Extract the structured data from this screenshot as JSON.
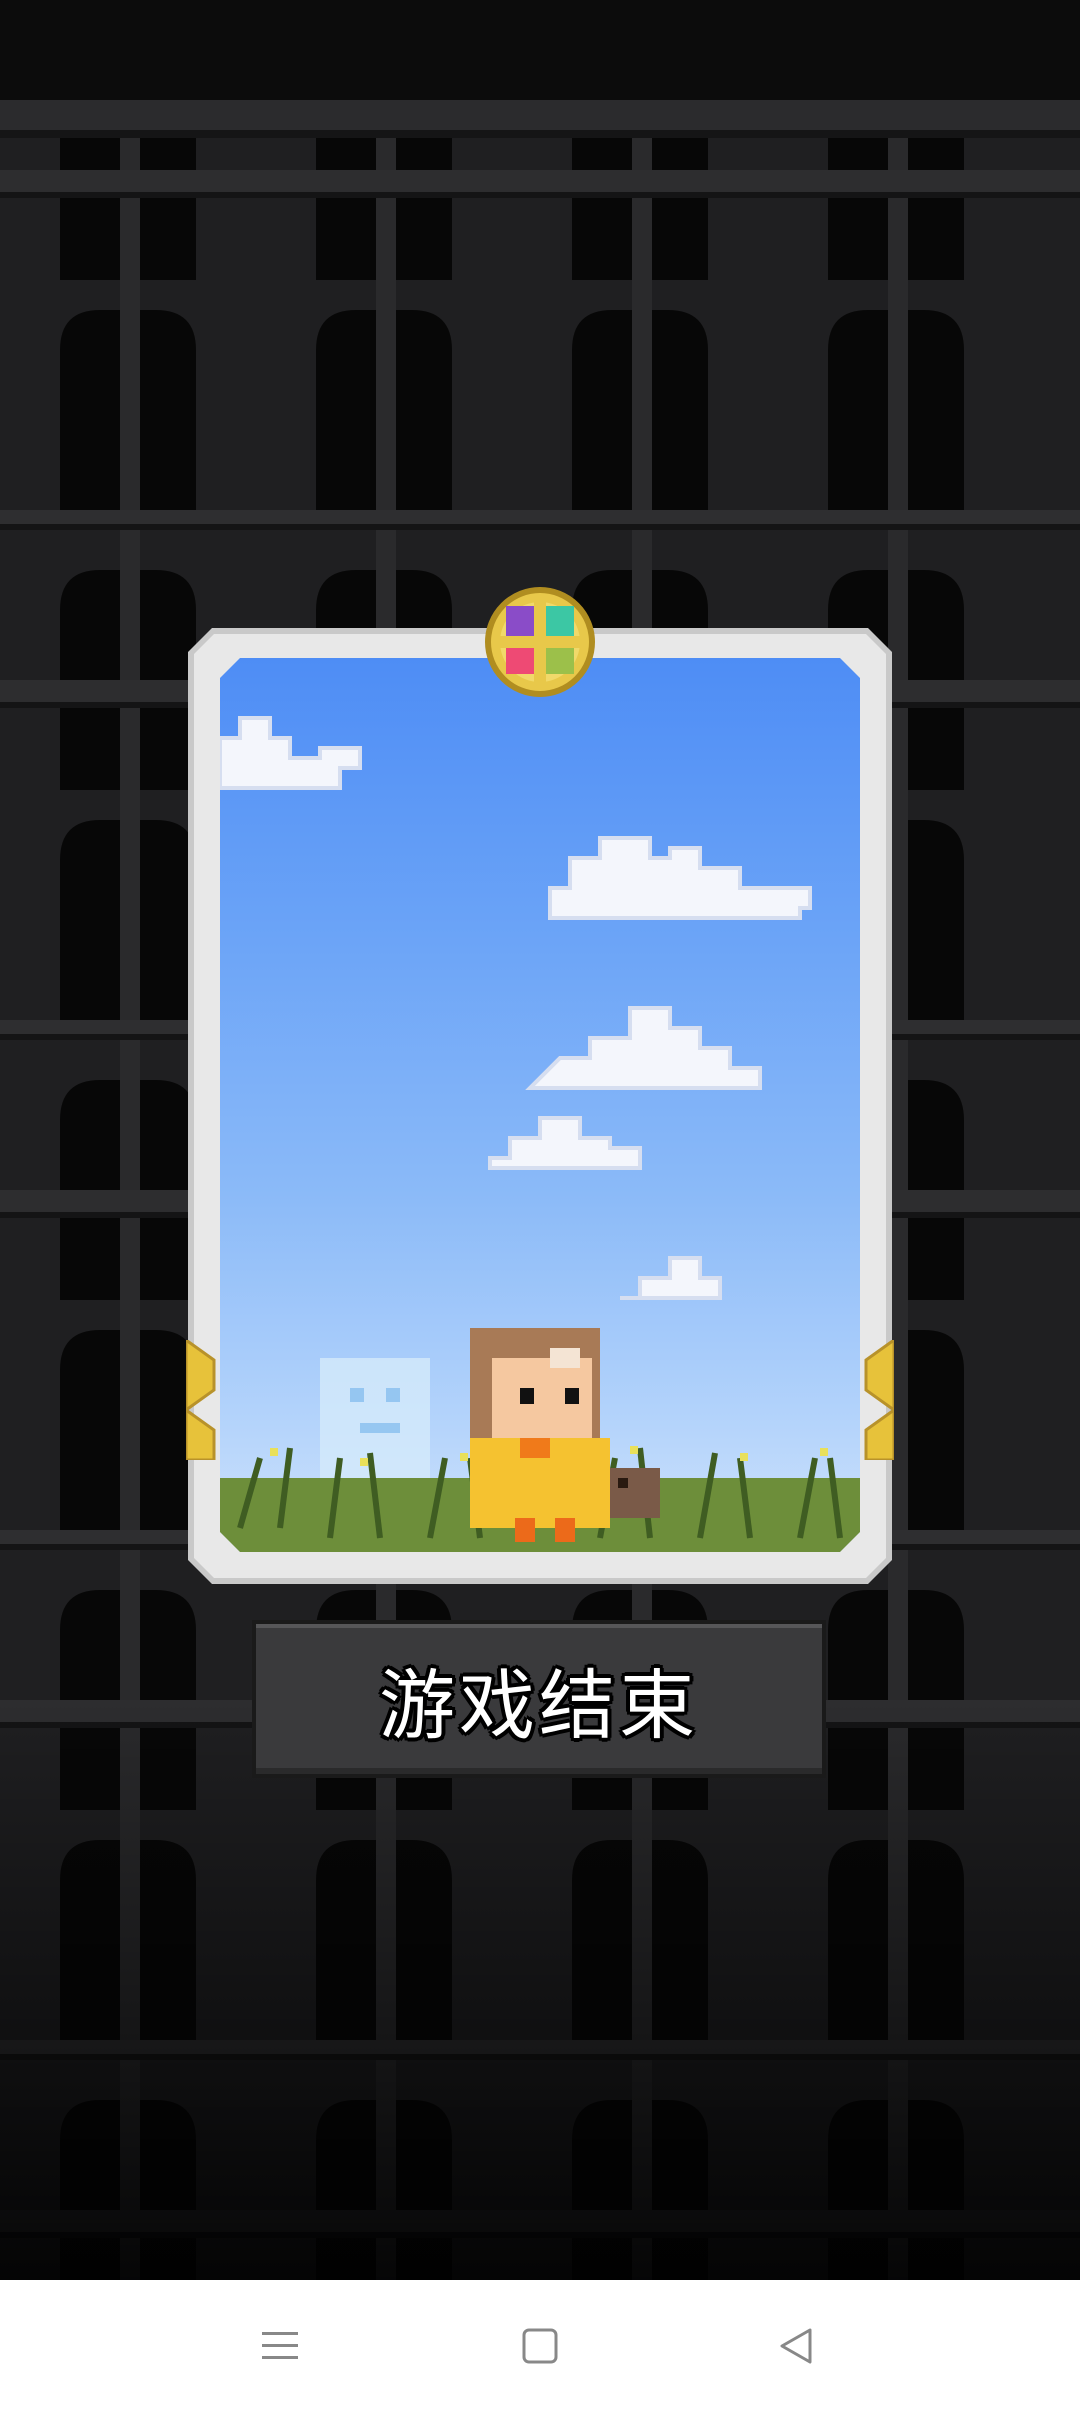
{
  "game": {
    "status_label": "游戏结束"
  },
  "navbar": {
    "menu_icon": "menu-icon",
    "home_icon": "home-icon",
    "back_icon": "back-icon"
  },
  "colors": {
    "sky_top": "#4e8df5",
    "sky_bottom": "#cfe3fc",
    "card_frame": "#c9c9c9",
    "button_bg": "#3a3a3c",
    "background": "#1b1b1c"
  }
}
